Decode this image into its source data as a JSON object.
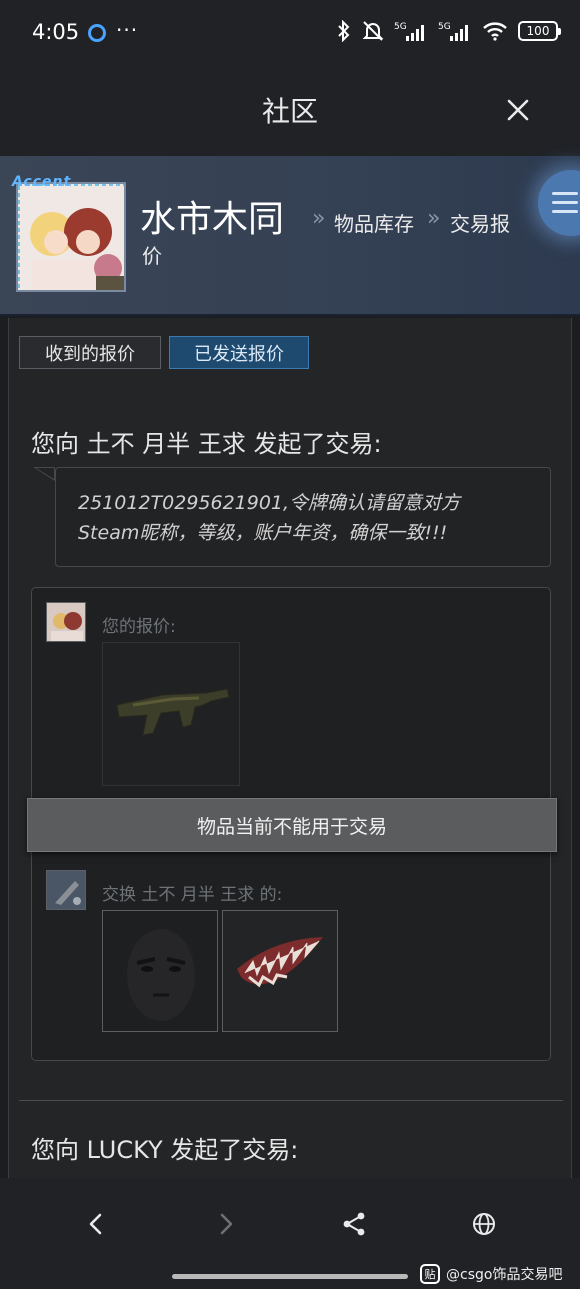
{
  "status_bar": {
    "time": "4:05",
    "more": "···",
    "battery": "100",
    "signal_1": "5G",
    "signal_2": "5G"
  },
  "title_bar": {
    "title": "社区"
  },
  "profile": {
    "avatar_text": "Accent",
    "name": "水市木同",
    "breadcrumb_1": "物品库存",
    "breadcrumb_2": "交易报",
    "breadcrumb_2_tail": "价",
    "separator": "»"
  },
  "tabs": {
    "received": "收到的报价",
    "sent": "已发送报价"
  },
  "offers": [
    {
      "heading": "您向 土不 月半 王求 发起了交易:",
      "message_line1": "251012T0295621901,令牌确认请留意对方",
      "message_line2": "Steam昵称，等级，账户年资，确保一致!!!",
      "your_offer_label": "您的报价:",
      "unavailable_notice": "物品当前不能用于交易",
      "exchange_label": "交换 土不 月半 王求 的:"
    },
    {
      "heading": "您向 LUCKY 发起了交易:"
    }
  ],
  "watermark": {
    "icon": "贴",
    "text": "@csgo饰品交易吧"
  },
  "colors": {
    "accent": "#1f4a70",
    "header_bg": "#354154",
    "page_bg": "#242527"
  }
}
